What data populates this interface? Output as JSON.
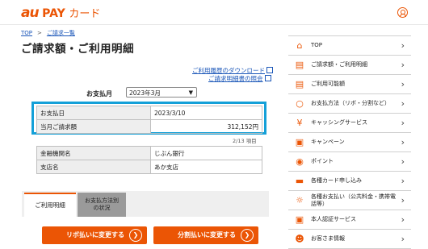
{
  "header": {
    "logo_au": "au",
    "logo_pay": "PAY",
    "logo_card": "カード"
  },
  "breadcrumb": {
    "top": "TOP",
    "sep": ">",
    "current": "ご請求一覧"
  },
  "page_title": "ご請求額・ご利用明細",
  "links": {
    "download": "ご利用履歴のダウンロード",
    "invoice": "ご請求明細書の照会"
  },
  "month": {
    "label": "お支払月",
    "selected": "2023年3月"
  },
  "summary": {
    "rows": [
      {
        "label": "お支払日",
        "value": "2023/3/10"
      },
      {
        "label": "当月ご請求額",
        "value": "312,152円"
      }
    ]
  },
  "page_count": "2/13 項目",
  "bank": {
    "rows": [
      {
        "label": "金融機関名",
        "value": "じぶん銀行"
      },
      {
        "label": "支店名",
        "value": "あか支店"
      }
    ]
  },
  "tabs": {
    "usage": "ご利用明細",
    "method_line1": "お支払方法別",
    "method_line2": "の状況"
  },
  "buttons": {
    "revo": "リボ払いに変更する",
    "installment": "分割払いに変更する"
  },
  "sidebar": {
    "items": [
      {
        "label": "TOP",
        "icon": "home-icon"
      },
      {
        "label": "ご請求額・ご利用明細",
        "icon": "document-icon"
      },
      {
        "label": "ご利用可能額",
        "icon": "document-icon"
      },
      {
        "label": "お支払方法（リボ・分割など）",
        "icon": "wallet-icon"
      },
      {
        "label": "キャッシングサービス",
        "icon": "yen-icon"
      },
      {
        "label": "キャンペーン",
        "icon": "gift-icon"
      },
      {
        "label": "ポイント",
        "icon": "point-icon"
      },
      {
        "label": "各種カード申し込み",
        "icon": "card-icon"
      },
      {
        "label": "各種お支払い（公共料金・携帯電話等）",
        "icon": "bulb-icon"
      },
      {
        "label": "本人認証サービス",
        "icon": "lock-icon"
      },
      {
        "label": "お客さま情報",
        "icon": "user-icon"
      }
    ]
  },
  "colors": {
    "brand": "#eb5505",
    "highlight": "#14a0d8",
    "link": "#1a56b8"
  }
}
